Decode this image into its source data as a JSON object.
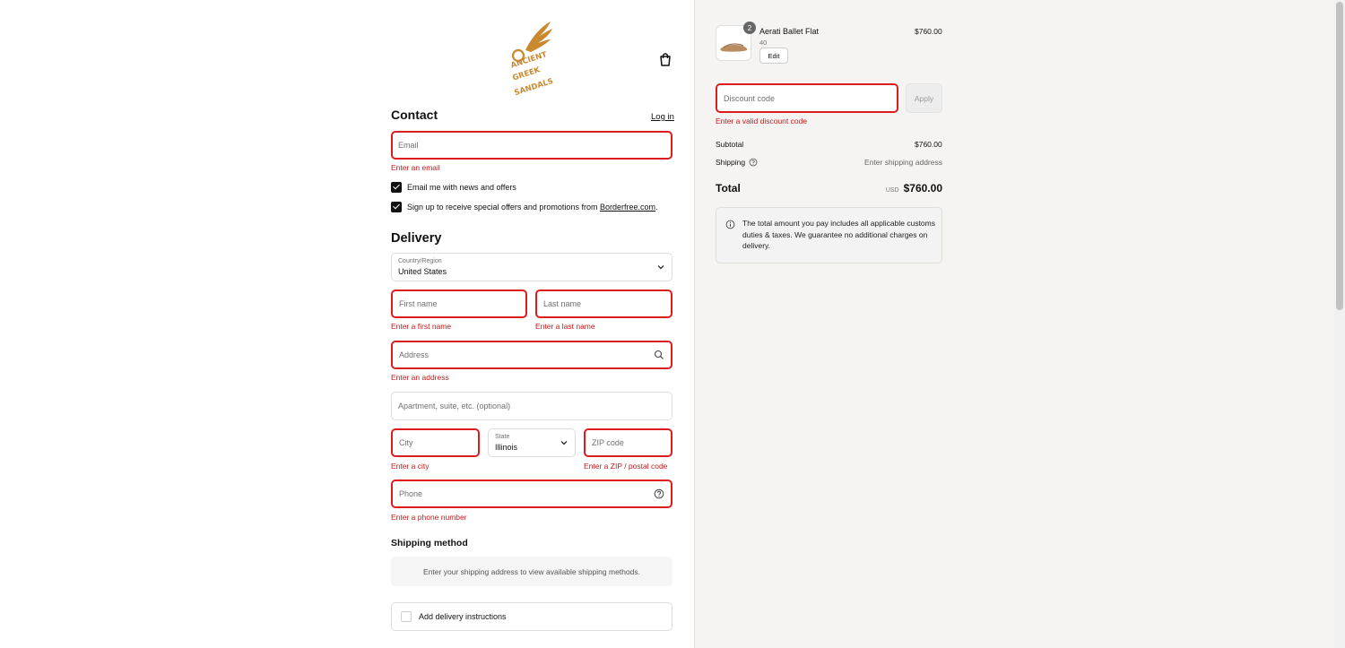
{
  "brand": {
    "logo_text": "ANCIENT GREEK SANDALS",
    "logo_color": "#c9892f"
  },
  "header": {
    "cart_icon": "shopping-bag-icon"
  },
  "contact": {
    "title": "Contact",
    "login_label": "Log in",
    "email_placeholder": "Email",
    "email_error": "Enter an email",
    "news_label": "Email me with news and offers",
    "news_checked": true,
    "borderfree_label_prefix": "Sign up to receive special offers and promotions from ",
    "borderfree_link": "Borderfree.com",
    "borderfree_label_suffix": ".",
    "borderfree_checked": true
  },
  "delivery": {
    "title": "Delivery",
    "country_label": "Country/Region",
    "country_value": "United States",
    "first_name_placeholder": "First name",
    "first_name_error": "Enter a first name",
    "last_name_placeholder": "Last name",
    "last_name_error": "Enter a last name",
    "address_placeholder": "Address",
    "address_error": "Enter an address",
    "apartment_placeholder": "Apartment, suite, etc. (optional)",
    "city_placeholder": "City",
    "city_error": "Enter a city",
    "state_label": "State",
    "state_value": "Illinois",
    "zip_placeholder": "ZIP code",
    "zip_error": "Enter a ZIP / postal code",
    "phone_placeholder": "Phone",
    "phone_error": "Enter a phone number"
  },
  "shipping_method": {
    "title": "Shipping method",
    "message": "Enter your shipping address to view available shipping methods.",
    "delivery_instructions_label": "Add delivery instructions"
  },
  "summary": {
    "item_name": "Aerati Ballet Flat",
    "item_variant": "40",
    "item_price": "$760.00",
    "item_quantity": "2",
    "edit_label": "Edit",
    "discount_placeholder": "Discount code",
    "discount_error": "Enter a valid discount code",
    "apply_label": "Apply",
    "subtotal_label": "Subtotal",
    "subtotal_value": "$760.00",
    "shipping_label": "Shipping",
    "shipping_value": "Enter shipping address",
    "total_label": "Total",
    "currency": "USD",
    "total_value": "$760.00",
    "duties_note": "The total amount you pay includes all applicable customs duties & taxes. We guarantee no additional charges on delivery."
  },
  "colors": {
    "error": "#dd1d1d",
    "error_text": "#c41a1a",
    "summary_bg": "#f6f4f2"
  }
}
